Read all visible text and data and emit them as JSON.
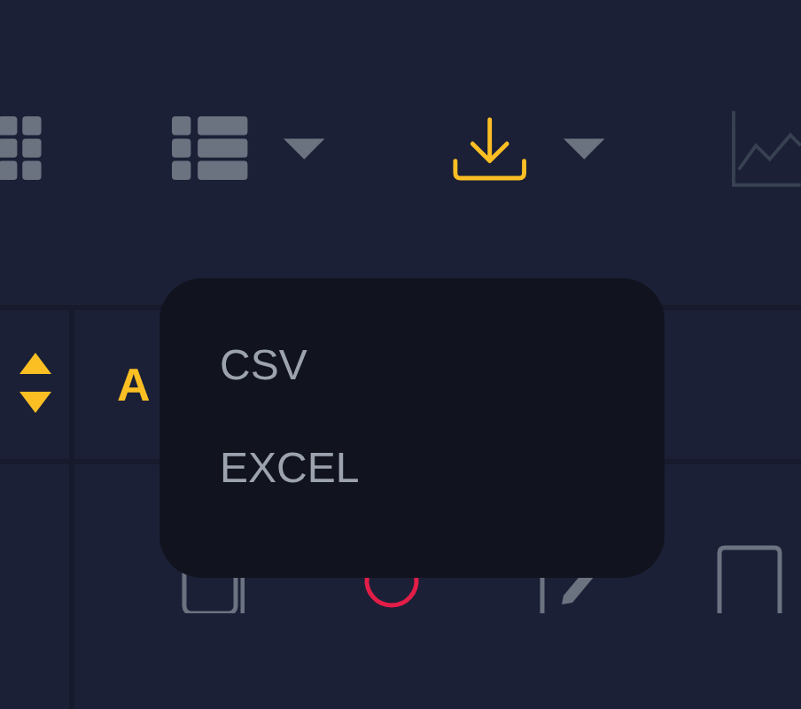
{
  "toolbar": {
    "export_button": {
      "active": true
    },
    "export_menu": {
      "expanded": true,
      "options": [
        {
          "label": "CSV"
        },
        {
          "label": "EXCEL"
        }
      ]
    }
  },
  "table": {
    "columns": [
      {
        "label": "A",
        "sorted": true
      }
    ]
  }
}
